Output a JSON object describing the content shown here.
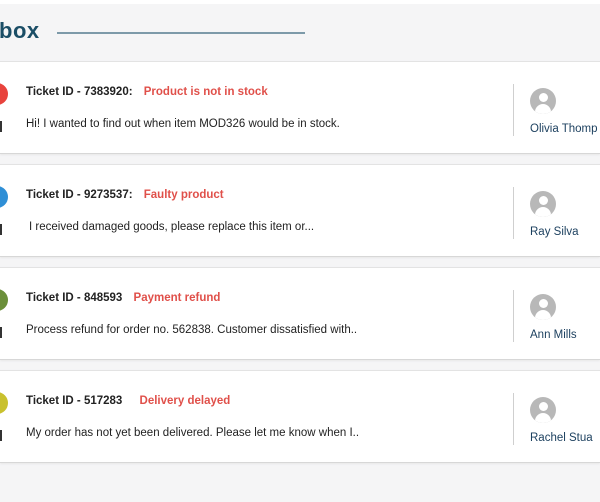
{
  "page": {
    "title": "box"
  },
  "tickets": [
    {
      "id_label": "Ticket ID - ",
      "id": "7383920:",
      "subject": "Product is not in stock",
      "preview": "Hi! I wanted to find out when item MOD326  would be in stock.",
      "agent": "Olivia Thomp",
      "status_color": "#e8433d",
      "status_icon": "circle-icon"
    },
    {
      "id_label": "Ticket ID - ",
      "id": "9273537:",
      "subject": "Faulty product",
      "preview": "I received damaged goods, please replace this item or...",
      "agent": "Ray Silva",
      "status_color": "#2f8fd6",
      "status_icon": "circle-icon"
    },
    {
      "id_label": "Ticket ID - ",
      "id": "848593",
      "subject": "Payment refund",
      "preview": "Process refund for order no. 562838. Customer dissatisfied with..",
      "agent": "Ann Mills",
      "status_color": "#6b8f3a",
      "status_icon": "circle-icon"
    },
    {
      "id_label": "Ticket ID - ",
      "id": "517283",
      "subject": "Delivery delayed",
      "preview": "My order has not yet been delivered. Please let me know when I..",
      "agent": "Rachel Stua",
      "status_color": "#c9c12e",
      "status_icon": "circle-icon"
    }
  ]
}
